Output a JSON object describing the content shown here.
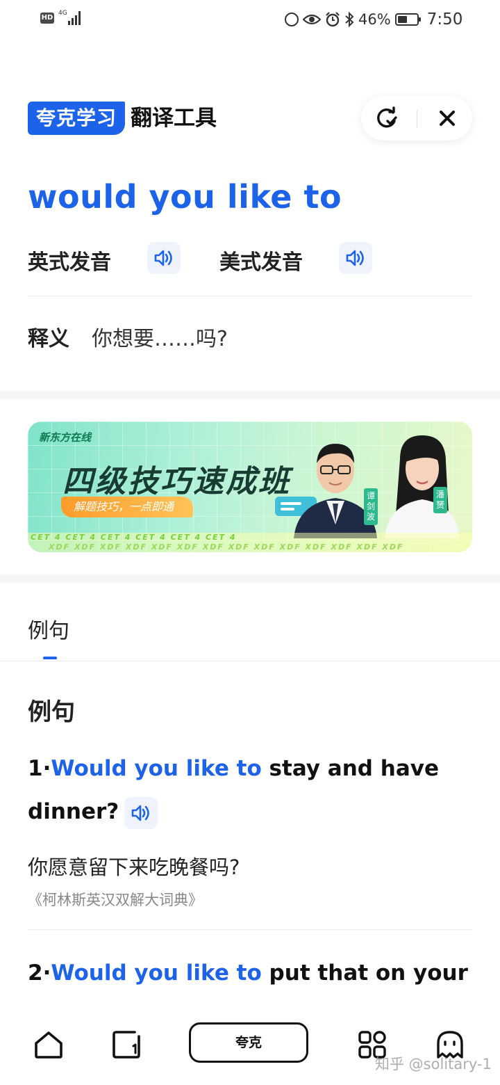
{
  "status_bar": {
    "hd_badge": "HD",
    "network_type": "4G",
    "battery_percent": "46%",
    "time": "7:50",
    "icons": [
      "mobile-data-icon",
      "eye-icon",
      "alarm-icon",
      "bluetooth-icon",
      "battery-icon"
    ]
  },
  "header": {
    "brand_label": "夸克学习",
    "tool_title": "翻译工具",
    "actions": [
      "refresh-check-icon",
      "close-icon"
    ]
  },
  "phrase": "would you like to",
  "pronunciation": {
    "uk_label": "英式发音",
    "us_label": "美式发音"
  },
  "meaning": {
    "label": "释义",
    "text": "你想要……吗?"
  },
  "banner": {
    "logo": "新东方在线",
    "title": "四级技巧速成班",
    "tagline": "解题技巧，一点即通",
    "teacher_left": "谭剑波",
    "teacher_right": "潘赟",
    "ribbon_top": "CET 4   CET 4   CET 4   CET 4   CET 4   CET 4",
    "ribbon_bottom": "XDF  XDF  XDF  XDF  XDF  XDF  XDF  XDF  XDF  XDF  XDF  XDF  XDF  XDF"
  },
  "examples_tab": "例句",
  "examples_title": "例句",
  "examples": [
    {
      "index": "1·",
      "highlight": "Would you like to",
      "rest_line1": " stay and have",
      "rest_line2": "dinner?",
      "translation": "你愿意留下来吃晚餐吗?",
      "source": "《柯林斯英汉双解大词典》"
    },
    {
      "index": "2·",
      "highlight": "Would you like to",
      "rest_line1": " put that on your"
    }
  ],
  "bottom_nav": {
    "center_label": "夸克",
    "items": [
      "home-icon",
      "tabs-icon",
      "apps-icon",
      "ghost-icon"
    ]
  },
  "watermark": "知乎 @solitary-1"
}
